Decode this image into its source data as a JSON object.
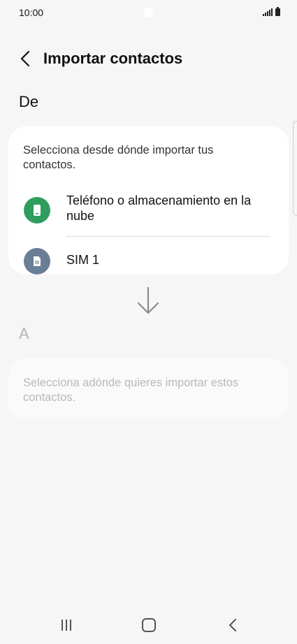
{
  "status_bar": {
    "time": "10:00"
  },
  "header": {
    "title": "Importar contactos",
    "back_icon": "chevron-left-icon"
  },
  "from_section": {
    "heading": "De",
    "description": "Selecciona desde dónde importar tus contactos.",
    "options": [
      {
        "label": "Teléfono o almacenamiento en la nube",
        "icon": "phone-icon",
        "icon_color": "#2f9d5e"
      },
      {
        "label": "SIM 1",
        "icon": "sim-card-icon",
        "icon_color": "#6a7e96"
      }
    ]
  },
  "to_section": {
    "heading": "A",
    "description": "Selecciona adónde quieres importar estos contactos."
  },
  "nav_bar": {
    "recents_icon": "recents-icon",
    "home_icon": "home-icon",
    "back_icon": "back-icon"
  }
}
